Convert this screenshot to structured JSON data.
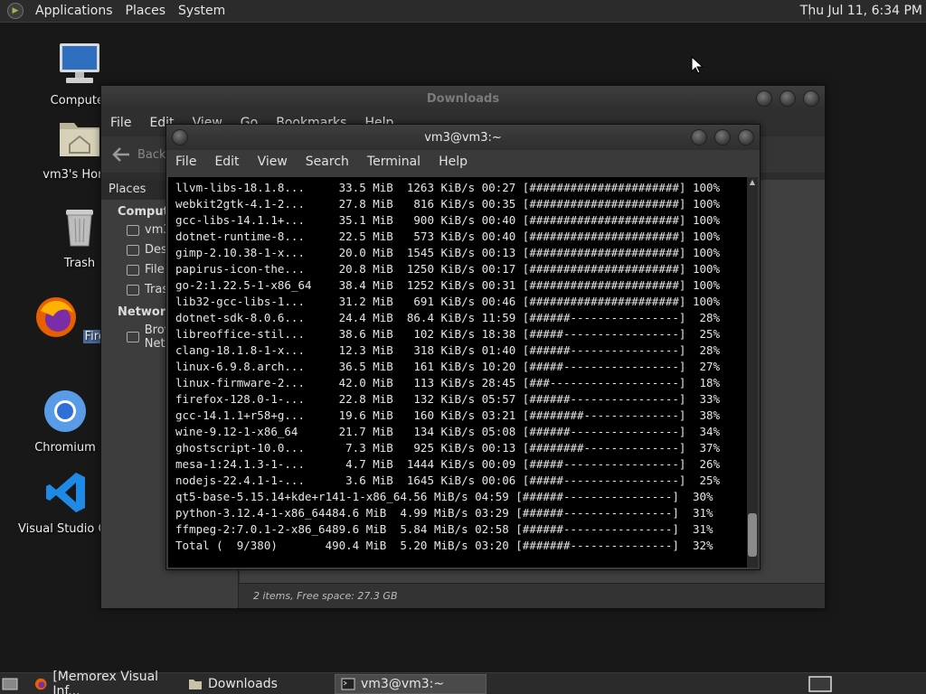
{
  "top_panel": {
    "menus": [
      "Applications",
      "Places",
      "System"
    ],
    "clock": "Thu Jul 11,  6:34 PM"
  },
  "desktop": {
    "icons": [
      {
        "label": "Computer",
        "icon": "computer-icon"
      },
      {
        "label": "vm3's Home",
        "icon": "home-folder-icon"
      },
      {
        "label": "Trash",
        "icon": "trash-icon"
      },
      {
        "label": "Firefox",
        "icon": "firefox-icon"
      },
      {
        "label": "Chromium",
        "icon": "chromium-icon"
      },
      {
        "label": "Visual Studio Code",
        "icon": "vscode-icon"
      }
    ]
  },
  "downloads_window": {
    "title": "Downloads",
    "menu": [
      "File",
      "Edit",
      "View",
      "Go",
      "Bookmarks",
      "Help"
    ],
    "back_label": "Back",
    "sidebar_header": "Places",
    "sidebar_sections": [
      {
        "title": "Computer",
        "items": [
          "vm3",
          "Desktop",
          "File System",
          "Trash"
        ]
      },
      {
        "title": "Network",
        "items": [
          "Browse Network"
        ]
      }
    ],
    "status": "2 items, Free space: 27.3 GB"
  },
  "terminal_window": {
    "title": "vm3@vm3:~",
    "menu": [
      "File",
      "Edit",
      "View",
      "Search",
      "Terminal",
      "Help"
    ],
    "lines": [
      "llvm-libs-18.1.8...     33.5 MiB  1263 KiB/s 00:27 [######################] 100%",
      "webkit2gtk-4.1-2...     27.8 MiB   816 KiB/s 00:35 [######################] 100%",
      "gcc-libs-14.1.1+...     35.1 MiB   900 KiB/s 00:40 [######################] 100%",
      "dotnet-runtime-8...     22.5 MiB   573 KiB/s 00:40 [######################] 100%",
      "gimp-2.10.38-1-x...     20.0 MiB  1545 KiB/s 00:13 [######################] 100%",
      "papirus-icon-the...     20.8 MiB  1250 KiB/s 00:17 [######################] 100%",
      "go-2:1.22.5-1-x86_64    38.4 MiB  1252 KiB/s 00:31 [######################] 100%",
      "lib32-gcc-libs-1...     31.2 MiB   691 KiB/s 00:46 [######################] 100%",
      "dotnet-sdk-8.0.6...     24.4 MiB  86.4 KiB/s 11:59 [######----------------]  28%",
      "libreoffice-stil...     38.6 MiB   102 KiB/s 18:38 [#####-----------------]  25%",
      "clang-18.1.8-1-x...     12.3 MiB   318 KiB/s 01:40 [######----------------]  28%",
      "linux-6.9.8.arch...     36.5 MiB   161 KiB/s 10:20 [#####-----------------]  27%",
      "linux-firmware-2...     42.0 MiB   113 KiB/s 28:45 [###-------------------]  18%",
      "firefox-128.0-1-...     22.8 MiB   132 KiB/s 05:57 [######----------------]  33%",
      "gcc-14.1.1+r58+g...     19.6 MiB   160 KiB/s 03:21 [########--------------]  38%",
      "wine-9.12-1-x86_64      21.7 MiB   134 KiB/s 05:08 [######----------------]  34%",
      "ghostscript-10.0...      7.3 MiB   925 KiB/s 00:13 [########--------------]  37%",
      "mesa-1:24.1.3-1-...      4.7 MiB  1444 KiB/s 00:09 [#####-----------------]  26%",
      "nodejs-22.4.1-1-...      3.6 MiB  1645 KiB/s 00:06 [#####-----------------]  25%",
      "qt5-base-5.15.14+kde+r141-1-x86_64.56 MiB/s 04:59 [######----------------]  30%",
      "python-3.12.4-1-x86_64484.6 MiB  4.99 MiB/s 03:29 [######----------------]  31%",
      "ffmpeg-2:7.0.1-2-x86_6489.6 MiB  5.84 MiB/s 02:58 [######----------------]  31%",
      "Total (  9/380)       490.4 MiB  5.20 MiB/s 03:20 [#######---------------]  32%"
    ]
  },
  "taskbar": {
    "tasks": [
      {
        "label": "[Memorex Visual Inf...",
        "icon": "firefox-icon"
      },
      {
        "label": "Downloads",
        "icon": "folder-icon"
      },
      {
        "label": "vm3@vm3:~",
        "icon": "terminal-icon"
      }
    ]
  }
}
